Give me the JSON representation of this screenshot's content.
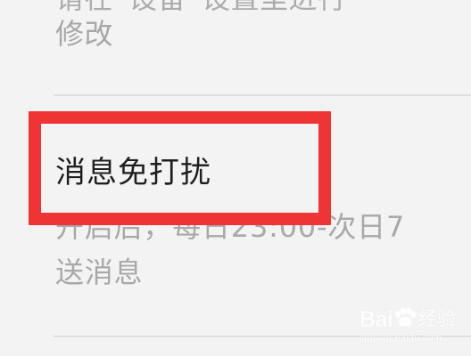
{
  "settings": {
    "previous_item": {
      "description_partial": "请在“设备”设置里进行",
      "description_end": "修改"
    },
    "do_not_disturb": {
      "title": "消息免打扰",
      "description_line1": "开启后，每日23:00-次日7",
      "description_line2": "送消息"
    }
  },
  "annotation": {
    "highlight_color": "#ef3434"
  },
  "watermark": {
    "logo_text": "Bai",
    "brand_cn": "经验",
    "url": "jingyan.baidu.com"
  }
}
